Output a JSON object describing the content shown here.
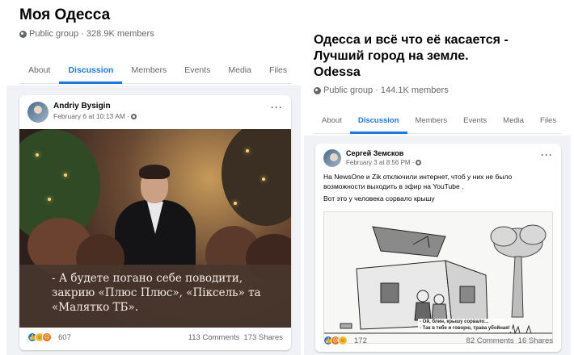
{
  "left_group": {
    "name": "Моя Одесса",
    "meta": "Public group · 328.9K members",
    "tabs": [
      {
        "label": "About",
        "active": false
      },
      {
        "label": "Discussion",
        "active": true
      },
      {
        "label": "Members",
        "active": false
      },
      {
        "label": "Events",
        "active": false
      },
      {
        "label": "Media",
        "active": false
      },
      {
        "label": "Files",
        "active": false
      }
    ],
    "post": {
      "author": "Andriy Bysigin",
      "time": "February 6 at 10:13 AM ·",
      "more": "···",
      "caption_lines": [
        "- А будете погано себе поводити,",
        "закрию «Плюс Плюс», «Піксель» та",
        "«Малятко ТБ»."
      ],
      "reaction_count": "607",
      "comments": "113 Comments",
      "shares": "173 Shares"
    }
  },
  "right_group": {
    "name_lines": [
      "Одесса и всё что её касается -",
      "Лучший город на земле.",
      "Odessa"
    ],
    "meta": "Public group · 144.1K members",
    "tabs": [
      {
        "label": "About",
        "active": false
      },
      {
        "label": "Discussion",
        "active": true
      },
      {
        "label": "Members",
        "active": false
      },
      {
        "label": "Events",
        "active": false
      },
      {
        "label": "Media",
        "active": false
      },
      {
        "label": "Files",
        "active": false
      }
    ],
    "post": {
      "author": "Сергей Земсков",
      "time": "February 3 at 8:56 PM ·",
      "more": "···",
      "text_lines": [
        "На NewsOne и Zik отключили интернет, чтоб у них не было возможности выходить в эфир на YouTube .",
        "Вот это у человека сорвало крышу"
      ],
      "cartoon_caption_lines": [
        "- Ой, блин, крышу сорвало...",
        "- Так в тебе и говорю, трава убойная!"
      ],
      "reaction_count": "172",
      "comments": "82 Comments",
      "shares": "16 Shares"
    }
  },
  "colors": {
    "accent": "#1877f2",
    "secondary_text": "#65676b",
    "feed_background": "#f0f2f5"
  },
  "icons": [
    "globe-icon",
    "more-options-icon",
    "like-reaction-icon",
    "haha-reaction-icon",
    "angry-reaction-icon"
  ]
}
